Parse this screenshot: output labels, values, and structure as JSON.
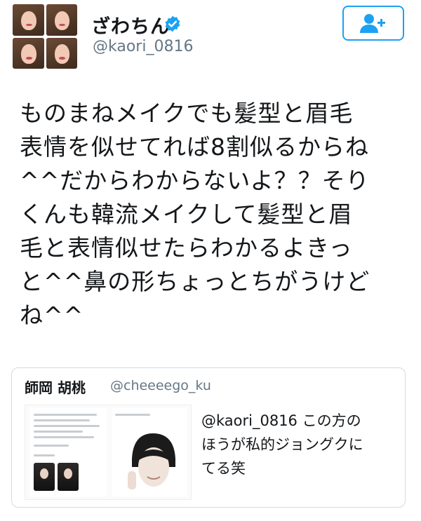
{
  "profile": {
    "display_name": "ざわちん",
    "handle": "@kaori_0816",
    "verified_icon": "verified-badge-icon",
    "avatar_icon": "profile-photo-collage"
  },
  "follow_button": {
    "icon": "follow-user-plus-icon",
    "accent_color": "#1da1f2"
  },
  "tweet": {
    "lines": [
      "ものまねメイクでも髪型と眉毛",
      "表情を似せてれば8割似るからね",
      "^^だからわからないよ？？そり",
      "くんも韓流メイクして髪型と眉",
      "毛と表情似せたらわかるよきっ",
      "と^^鼻の形ちょっとちがうけど",
      "ね^^"
    ]
  },
  "quoted_tweet": {
    "name": "師岡 胡桃",
    "handle": "@cheeeego_ku",
    "media_icon": "attached-screenshots-image",
    "lines": [
      "@kaori_0816 この方の",
      "ほうが私的ジョングクに",
      "てる笑"
    ]
  },
  "colors": {
    "text": "#14171a",
    "secondary_text": "#657786",
    "border": "#d3dbe1"
  }
}
